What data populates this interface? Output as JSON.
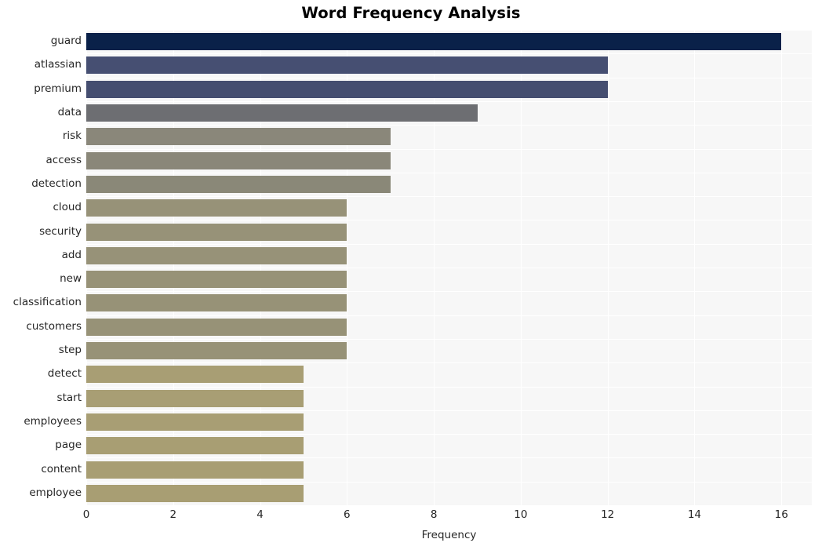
{
  "chart_data": {
    "type": "bar",
    "orientation": "horizontal",
    "title": "Word Frequency Analysis",
    "xlabel": "Frequency",
    "ylabel": "",
    "xlim": [
      0,
      16.7
    ],
    "ylim": [
      0,
      20
    ],
    "grid": true,
    "legend": null,
    "xticks": [
      0,
      2,
      4,
      6,
      8,
      10,
      12,
      14,
      16
    ],
    "xticklabels": [
      "0",
      "2",
      "4",
      "6",
      "8",
      "10",
      "12",
      "14",
      "16"
    ],
    "categories": [
      "guard",
      "atlassian",
      "premium",
      "data",
      "risk",
      "access",
      "detection",
      "cloud",
      "security",
      "add",
      "new",
      "classification",
      "customers",
      "step",
      "detect",
      "start",
      "employees",
      "page",
      "content",
      "employee"
    ],
    "values": [
      16,
      12,
      12,
      9,
      7,
      7,
      7,
      6,
      6,
      6,
      6,
      6,
      6,
      6,
      5,
      5,
      5,
      5,
      5,
      5
    ],
    "bar_colors": [
      "#0a2149",
      "#464f72",
      "#454e70",
      "#6d6e72",
      "#8a877a",
      "#8a8779",
      "#8a8878",
      "#979278",
      "#979278",
      "#979278",
      "#979277",
      "#979277",
      "#979277",
      "#979277",
      "#a89e74",
      "#a89e74",
      "#a89e74",
      "#a89e73",
      "#a89e73",
      "#a89e73"
    ],
    "plot_background": "#f7f7f7",
    "figure_background": "#ffffff",
    "grid_color": "#ffffff"
  }
}
